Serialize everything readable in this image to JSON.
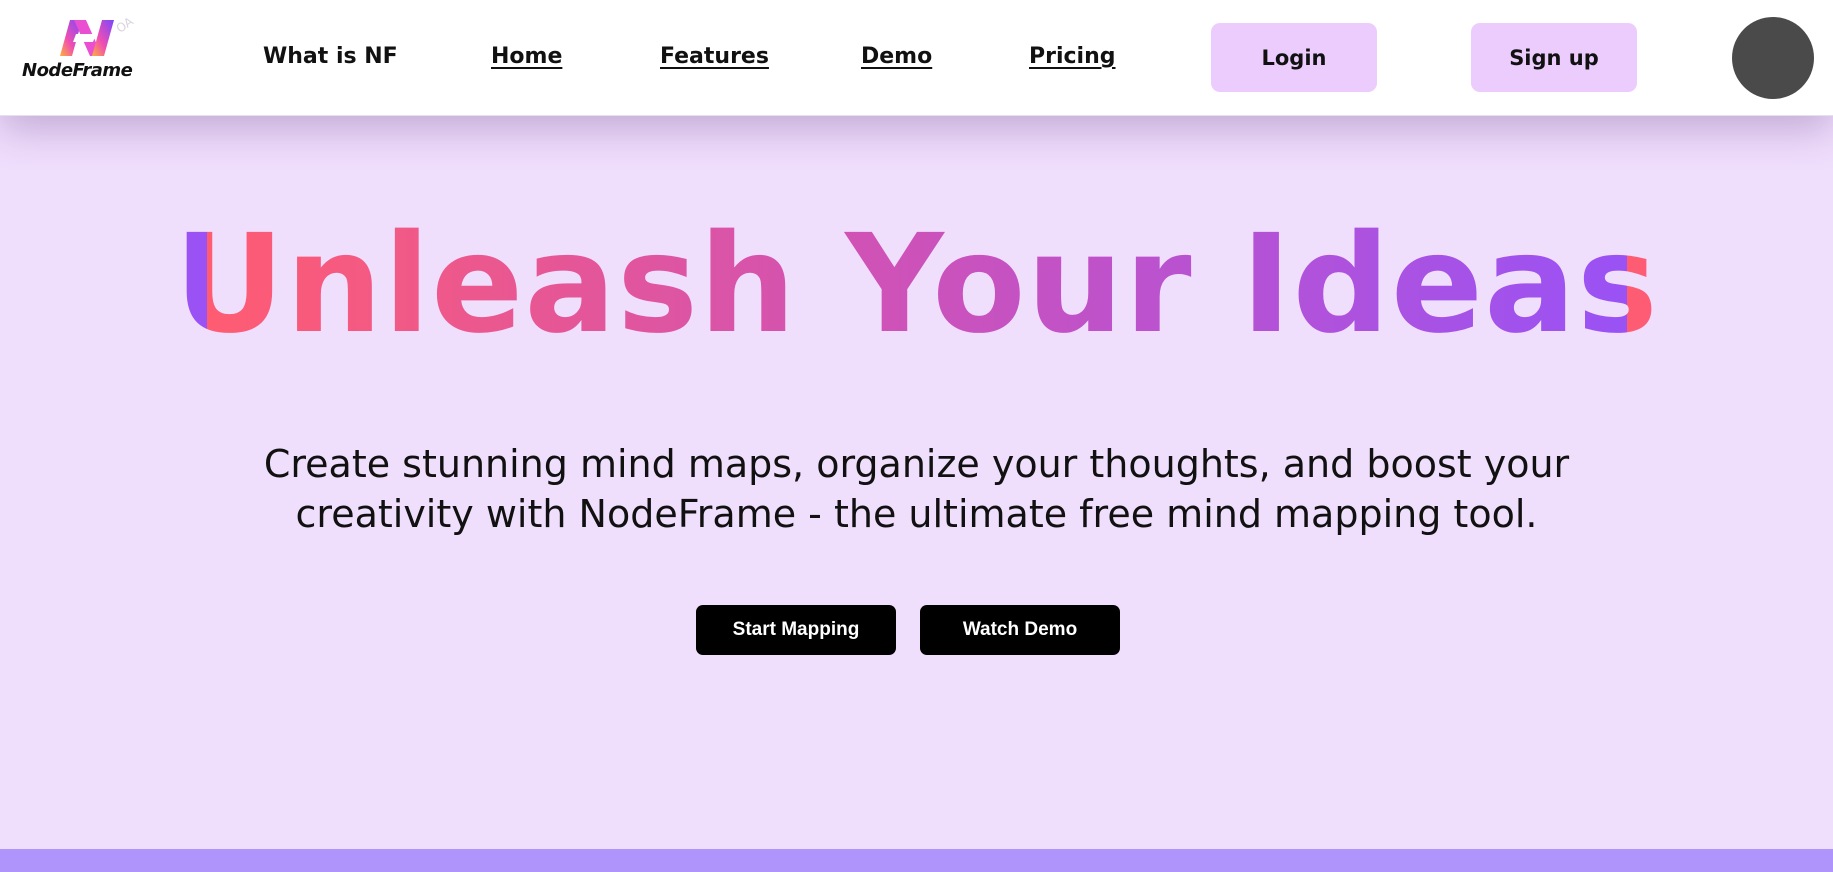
{
  "brand": {
    "name": "NodeFrame",
    "badge": "OA",
    "colors": {
      "mark_start": "#ff6f6f",
      "mark_mid": "#e040c8",
      "mark_end": "#7a46ff"
    }
  },
  "nav": {
    "links": [
      {
        "label": "What is NF",
        "underlined": false
      },
      {
        "label": "Home",
        "underlined": true
      },
      {
        "label": "Features",
        "underlined": true
      },
      {
        "label": "Demo",
        "underlined": true
      },
      {
        "label": "Pricing",
        "underlined": true
      }
    ],
    "login_label": "Login",
    "signup_label": "Sign up"
  },
  "hero": {
    "title": "Unleash Your Ideas",
    "subtitle": "Create stunning mind maps, organize your thoughts, and boost your creativity with NodeFrame - the ultimate free mind mapping tool.",
    "primary_cta": "Start Mapping",
    "secondary_cta": "Watch Demo"
  },
  "colors": {
    "page_background": "#f0defd",
    "nav_background": "#ffffff",
    "auth_button": "#ebccfd",
    "cta_button": "#000000",
    "title_gradient_start": "#ff5c72",
    "title_gradient_end": "#9a52f5",
    "bottom_band": "#ae94fb",
    "avatar": "#4a4a4a"
  }
}
